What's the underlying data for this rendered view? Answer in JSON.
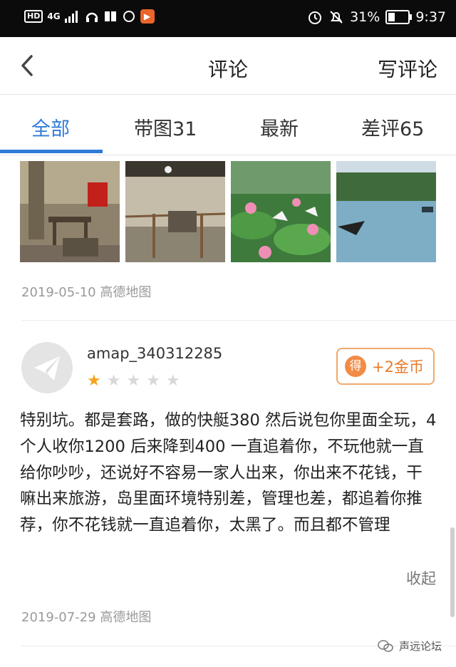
{
  "status_bar": {
    "hd_label": "HD",
    "network": "4G",
    "battery_percent": "31%",
    "time": "9:37"
  },
  "header": {
    "title": "评论",
    "write_label": "写评论"
  },
  "tabs": [
    {
      "label": "全部",
      "active": true
    },
    {
      "label": "带图31",
      "active": false
    },
    {
      "label": "最新",
      "active": false
    },
    {
      "label": "差评65",
      "active": false
    }
  ],
  "prev_review": {
    "photos": [
      "indoor-room-photo",
      "exhibit-hall-photo",
      "lotus-pond-photo",
      "lake-boat-photo"
    ],
    "date_source": "2019-05-10 高德地图"
  },
  "review": {
    "username": "amap_340312285",
    "rating": 1,
    "max_rating": 5,
    "coin_icon_char": "得",
    "coin_label": "+2金币",
    "text": "特别坑。都是套路，做的快艇380 然后说包你里面全玩，4个人收你1200 后来降到400 一直追着你，不玩他就一直给你吵吵，还说好不容易一家人出来，你出来不花钱，干嘛出来旅游，岛里面环境特别差，管理也差，都追着你推荐，你不花钱就一直追着你，太黑了。而且都不管理",
    "collapse_label": "收起",
    "date_source": "2019-07-29 高德地图"
  },
  "watermark": "声远论坛",
  "colors": {
    "accent": "#2f7bd8",
    "coin": "#e87a2a",
    "star_on": "#f6a21a"
  }
}
